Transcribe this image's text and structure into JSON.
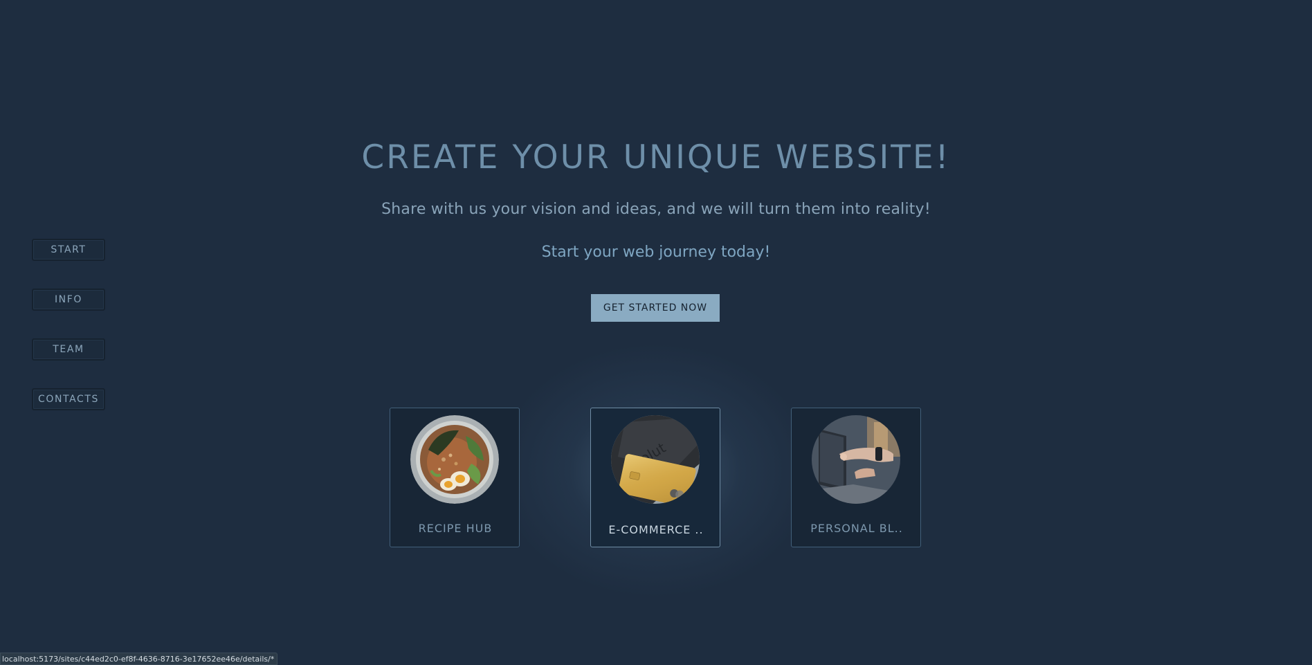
{
  "nav": {
    "items": [
      {
        "label": "START"
      },
      {
        "label": "INFO"
      },
      {
        "label": "TEAM"
      },
      {
        "label": "CONTACTS"
      }
    ]
  },
  "hero": {
    "title": "CREATE YOUR UNIQUE WEBSITE!",
    "subtitle": "Share with us your vision and ideas, and we will turn them into reality!",
    "journey": "Start your web journey today!",
    "cta_label": "GET STARTED NOW"
  },
  "cards": [
    {
      "label": "RECIPE HUB",
      "image_icon": "ramen-bowl-image"
    },
    {
      "label": "E-COMMERCE ..",
      "image_icon": "credit-card-image"
    },
    {
      "label": "PERSONAL BL..",
      "image_icon": "laptop-hands-image"
    }
  ],
  "status_bar": {
    "url": "localhost:5173/sites/c44ed2c0-ef8f-4636-8716-3e17652ee46e/details/*"
  },
  "colors": {
    "background": "#1e2d40",
    "accent": "#8aabc2",
    "title": "#6e8fa9"
  }
}
